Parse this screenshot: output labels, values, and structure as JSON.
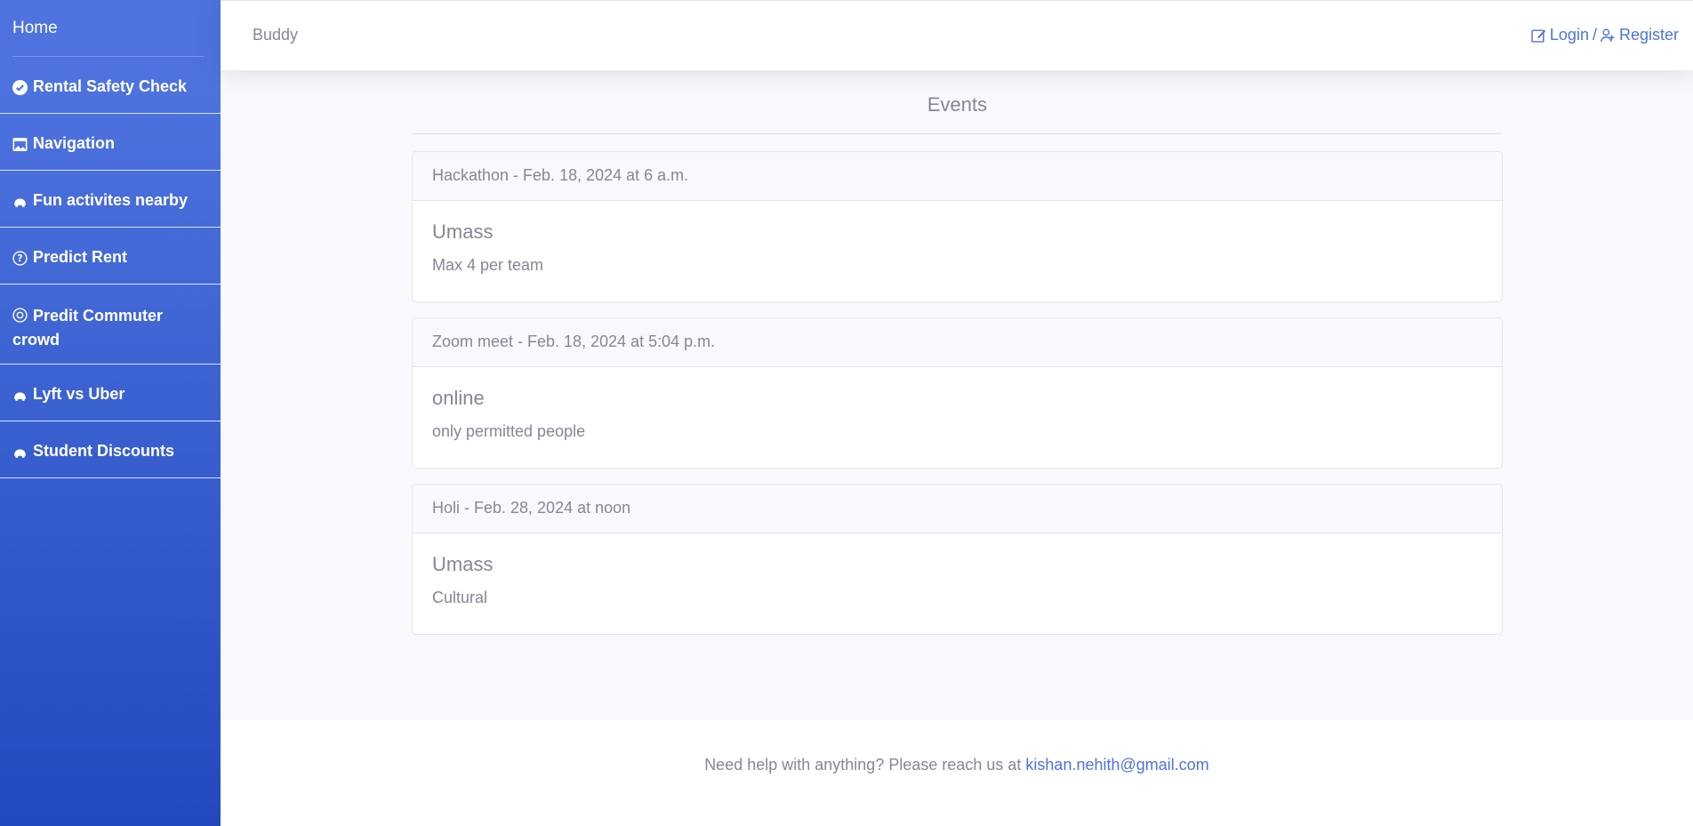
{
  "sidebar": {
    "home": "Home",
    "items": [
      {
        "label": "Rental Safety Check",
        "icon": "check-circle-icon"
      },
      {
        "label": "Navigation",
        "icon": "window-icon"
      },
      {
        "label": "Fun activites nearby",
        "icon": "car-icon"
      },
      {
        "label": "Predict Rent",
        "icon": "question-circle-icon"
      },
      {
        "label": "Predit Commuter crowd",
        "icon": "target-circle-icon"
      },
      {
        "label": "Lyft vs Uber",
        "icon": "car-icon"
      },
      {
        "label": "Student Discounts",
        "icon": "car-icon"
      }
    ]
  },
  "topbar": {
    "brand": "Buddy",
    "login": "Login",
    "separator": "/",
    "register": "Register"
  },
  "main": {
    "title": "Events",
    "events": [
      {
        "header": "Hackathon - Feb. 18, 2024 at 6 a.m.",
        "title": "Umass",
        "text": "Max 4 per team"
      },
      {
        "header": "Zoom meet - Feb. 18, 2024 at 5:04 p.m.",
        "title": "online",
        "text": "only permitted people"
      },
      {
        "header": "Holi - Feb. 28, 2024 at noon",
        "title": "Umass",
        "text": "Cultural"
      }
    ]
  },
  "footer": {
    "text": "Need help with anything? Please reach us at ",
    "email": "kishan.nehith@gmail.com"
  },
  "colors": {
    "sidebar_top": "#4e73df",
    "sidebar_bottom": "#224abe",
    "link": "#4e73df",
    "text_muted": "#858796",
    "page_bg": "#f8f9fc"
  }
}
